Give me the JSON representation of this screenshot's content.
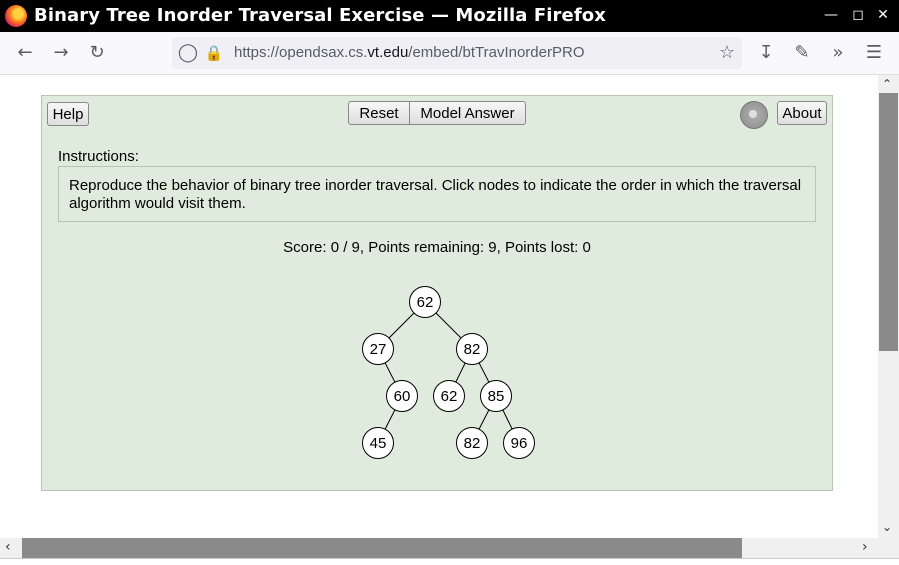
{
  "window": {
    "title": "Binary Tree Inorder Traversal Exercise — Mozilla Firefox"
  },
  "toolbar": {
    "url_host_prefix": "https://opendsax.cs.",
    "url_host_main": "vt.edu",
    "url_path": "/embed/btTravInorderPRO"
  },
  "exercise": {
    "help_label": "Help",
    "reset_label": "Reset",
    "model_answer_label": "Model Answer",
    "about_label": "About",
    "instructions_label": "Instructions:",
    "instructions_text": "Reproduce the behavior of binary tree inorder traversal. Click nodes to indicate the order in which the traversal algorithm would visit them.",
    "score_text": "Score: 0 / 9, Points remaining: 9, Points lost: 0"
  },
  "tree": {
    "nodes": [
      {
        "id": "n62root",
        "value": "62"
      },
      {
        "id": "n27",
        "value": "27"
      },
      {
        "id": "n82top",
        "value": "82"
      },
      {
        "id": "n60",
        "value": "60"
      },
      {
        "id": "n62left",
        "value": "62"
      },
      {
        "id": "n85",
        "value": "85"
      },
      {
        "id": "n45",
        "value": "45"
      },
      {
        "id": "n82bottom",
        "value": "82"
      },
      {
        "id": "n96",
        "value": "96"
      }
    ]
  },
  "colors": {
    "panel": "#dfebdc",
    "titlebar": "#000000"
  }
}
